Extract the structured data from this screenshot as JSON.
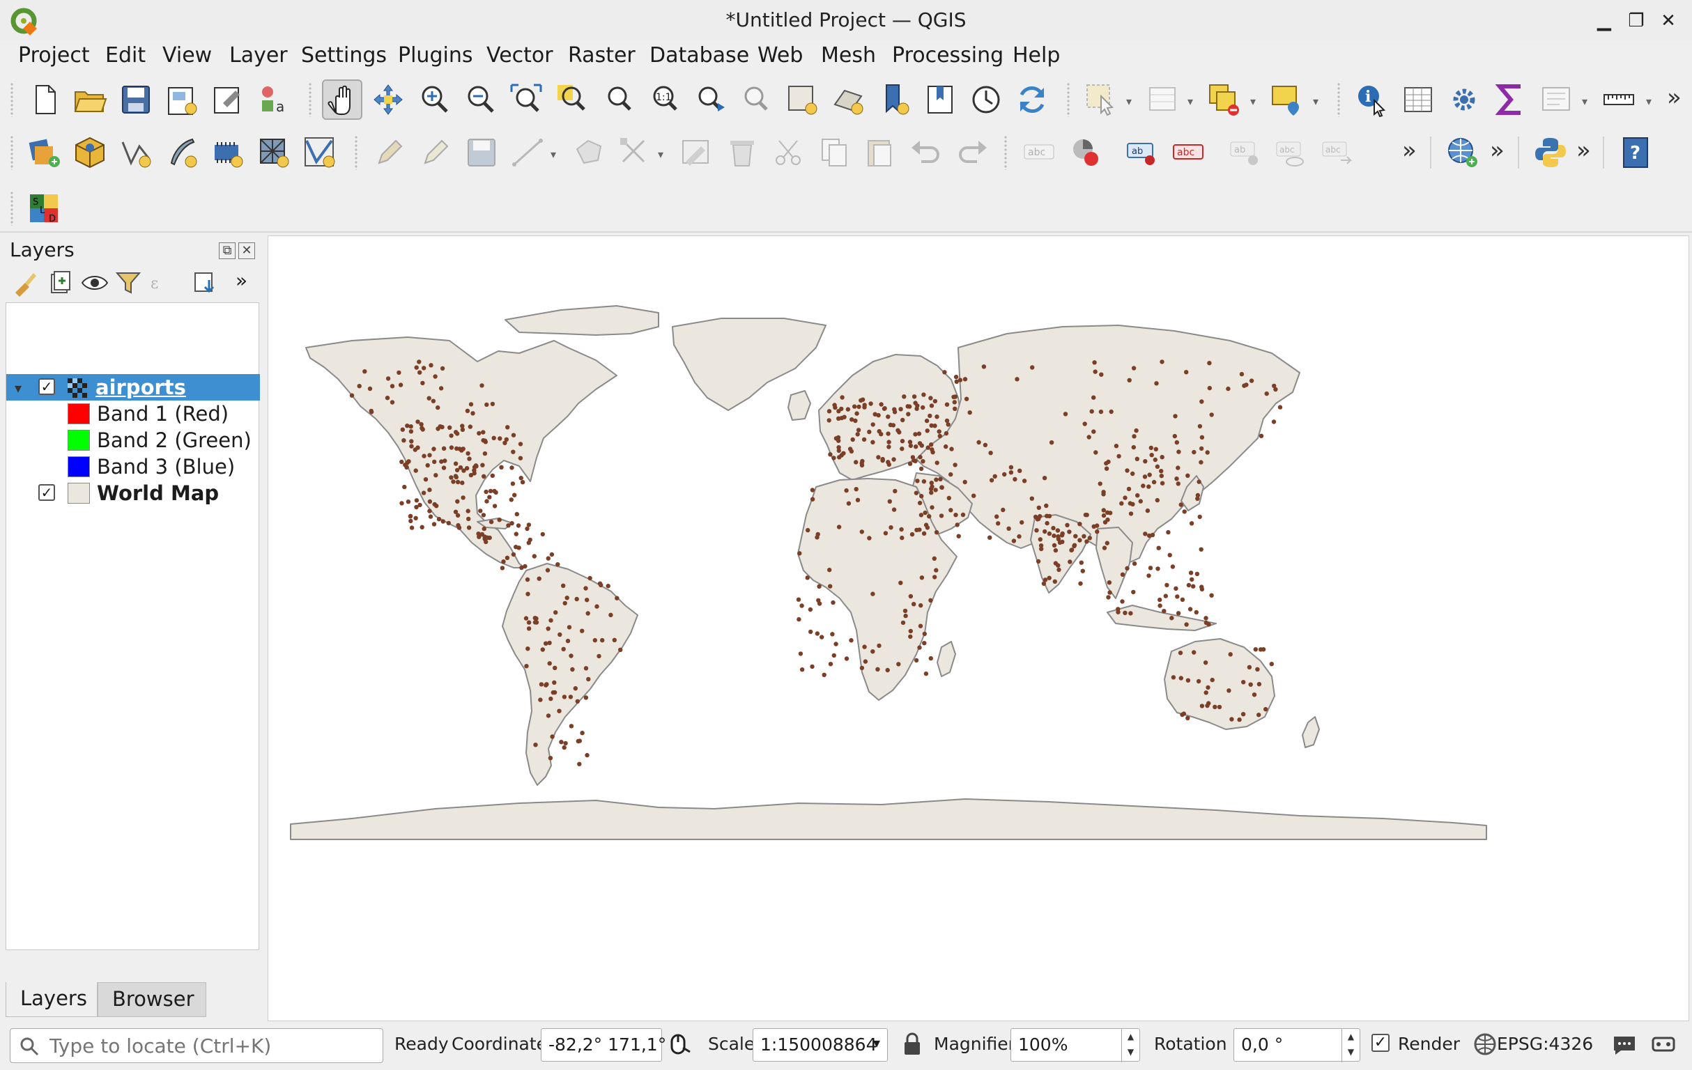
{
  "window": {
    "title": "*Untitled Project — QGIS",
    "minimize_glyph": "▁",
    "restore_glyph": "❐",
    "close_glyph": "✕"
  },
  "menubar": {
    "items": [
      "Project",
      "Edit",
      "View",
      "Layer",
      "Settings",
      "Plugins",
      "Vector",
      "Raster",
      "Database",
      "Web",
      "Mesh",
      "Processing",
      "Help"
    ]
  },
  "toolbars": {
    "overflow_glyph": "»",
    "help_glyph": "?",
    "label_abc": "abc",
    "label_ab": "ab",
    "zoom_native": "1:1"
  },
  "layers_panel": {
    "title": "Layers",
    "float_glyph": "⧉",
    "close_glyph": "✕",
    "tree": [
      {
        "name": "airports",
        "type": "raster",
        "checked": true,
        "expanded": true,
        "selected": true
      },
      {
        "name": "Band 1 (Red)",
        "legend": true,
        "color": "#ff0000"
      },
      {
        "name": "Band 2 (Green)",
        "legend": true,
        "color": "#00ff00"
      },
      {
        "name": "Band 3 (Blue)",
        "legend": true,
        "color": "#0000ff"
      },
      {
        "name": "World Map",
        "type": "vector",
        "checked": true,
        "bold": true,
        "color": "#ebe7de"
      }
    ],
    "expand_glyph": "▾",
    "check_glyph": "✓",
    "overflow_glyph": "»"
  },
  "bottom_tabs": {
    "layers": "Layers",
    "browser": "Browser"
  },
  "map": {
    "background": "#ffffff",
    "land_color": "#ebe7de",
    "border_color": "#8a8a8a",
    "point_color": "#7b3f27"
  },
  "statusbar": {
    "locator_placeholder": "Type to locate (Ctrl+K)",
    "ready": "Ready",
    "coordinate_label": "Coordinate",
    "coordinate_value": "-82,2° 171,1°",
    "scale_label": "Scale",
    "scale_value": "1:150008864",
    "magnifier_label": "Magnifier",
    "magnifier_value": "100%",
    "rotation_label": "Rotation",
    "rotation_value": "0,0 °",
    "render_label": "Render",
    "render_checked": true,
    "crs": "EPSG:4326",
    "check_glyph": "✓",
    "dropdown_glyph": "▾",
    "spin_up": "▲",
    "spin_down": "▼"
  }
}
